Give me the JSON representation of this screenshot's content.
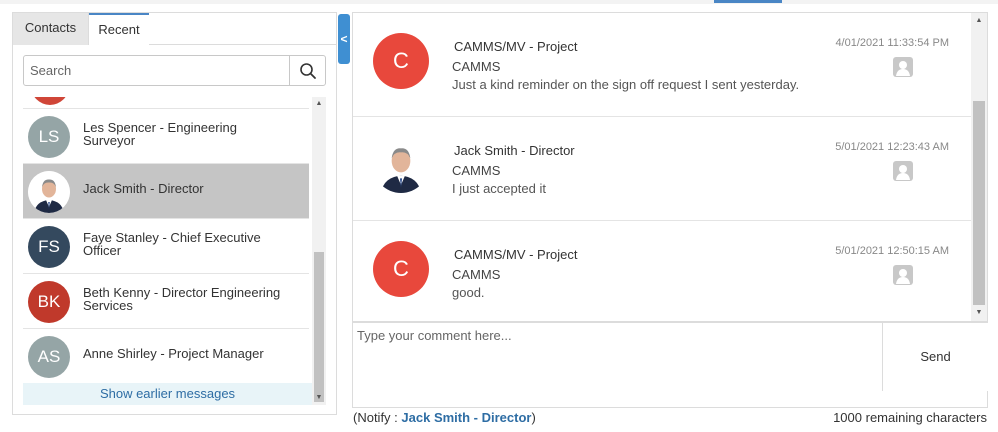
{
  "tabs": {
    "contacts": "Contacts",
    "recent": "Recent"
  },
  "search": {
    "placeholder": "Search"
  },
  "contacts": [
    {
      "initials": "LS",
      "line1": "Les Spencer - Engineering",
      "line2": "Surveyor",
      "color": "#95a5a6"
    },
    {
      "initials": "",
      "line1": "Jack Smith - Director",
      "line2": "",
      "color": "#ffffff"
    },
    {
      "initials": "FS",
      "line1": "Faye Stanley - Chief Executive",
      "line2": "Officer",
      "color": "#34495e"
    },
    {
      "initials": "BK",
      "line1": "Beth Kenny - Director Engineering",
      "line2": "Services",
      "color": "#c0392b"
    },
    {
      "initials": "AS",
      "line1": "Anne Shirley - Project Manager",
      "line2": "",
      "color": "#95a5a6"
    }
  ],
  "show_earlier": "Show earlier messages",
  "collapse_glyph": "<",
  "messages": [
    {
      "initial": "C",
      "from": "CAMMS/MV - Project",
      "subject": "CAMMS",
      "body": "Just a kind reminder on the sign off request I sent yesterday.",
      "time": "4/01/2021 11:33:54 PM"
    },
    {
      "initial": "",
      "from": "Jack Smith - Director",
      "subject": "CAMMS",
      "body": "I just accepted it",
      "time": "5/01/2021 12:23:43 AM"
    },
    {
      "initial": "C",
      "from": "CAMMS/MV - Project",
      "subject": "CAMMS",
      "body": "good.",
      "time": "5/01/2021 12:50:15 AM"
    }
  ],
  "comment": {
    "placeholder": "Type your comment here...",
    "send": "Send"
  },
  "notify": {
    "prefix": "(Notify : ",
    "name": "Jack Smith - Director",
    "suffix": ")"
  },
  "remaining": "1000 remaining characters",
  "colors": {
    "accent": "#4a86c5",
    "selected_row": "#c5c5c5",
    "link": "#2e6da4",
    "avatar_c": "#e8483c"
  }
}
